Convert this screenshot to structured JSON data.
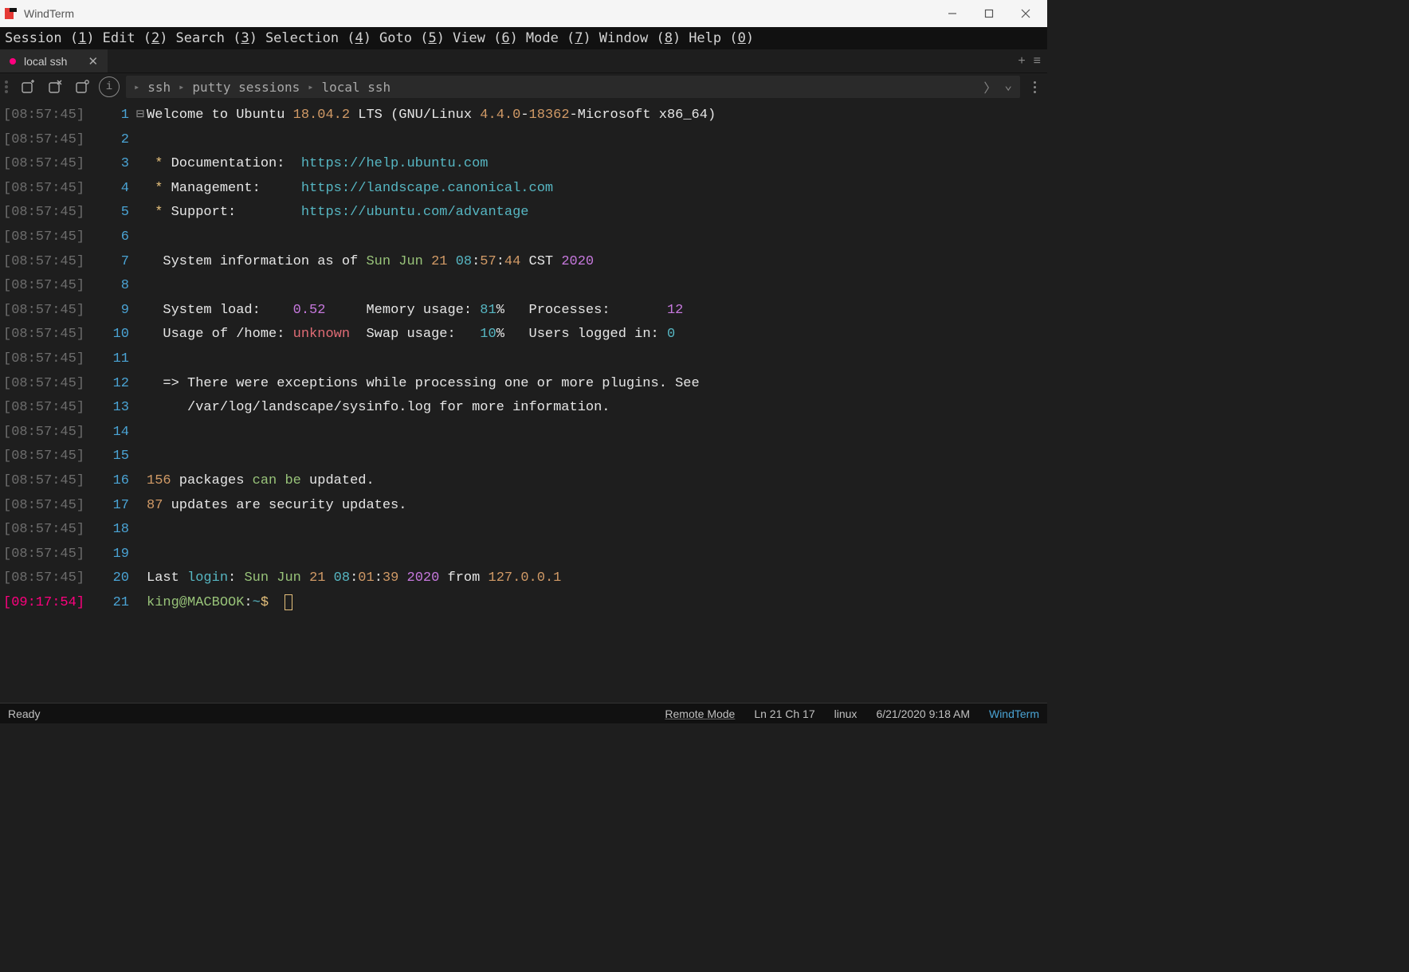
{
  "titlebar": {
    "title": "WindTerm"
  },
  "menubar": {
    "items": [
      {
        "label": "Session",
        "key": "1"
      },
      {
        "label": "Edit",
        "key": "2"
      },
      {
        "label": "Search",
        "key": "3"
      },
      {
        "label": "Selection",
        "key": "4"
      },
      {
        "label": "Goto",
        "key": "5"
      },
      {
        "label": "View",
        "key": "6"
      },
      {
        "label": "Mode",
        "key": "7"
      },
      {
        "label": "Window",
        "key": "8"
      },
      {
        "label": "Help",
        "key": "0"
      }
    ]
  },
  "tab": {
    "label": "local ssh"
  },
  "breadcrumb": {
    "items": [
      "ssh",
      "putty sessions",
      "local ssh"
    ]
  },
  "lines": [
    {
      "ts": "[08:57:45]",
      "ln": "1",
      "fold": "⊟",
      "tokens": [
        {
          "t": "Welcome to Ubuntu ",
          "c": "c-white"
        },
        {
          "t": "18.04.2",
          "c": "c-num"
        },
        {
          "t": " LTS (GNU/Linux ",
          "c": "c-white"
        },
        {
          "t": "4.4.0",
          "c": "c-num"
        },
        {
          "t": "-",
          "c": "c-white"
        },
        {
          "t": "18362",
          "c": "c-num"
        },
        {
          "t": "-Microsoft x86_64)",
          "c": "c-white"
        }
      ]
    },
    {
      "ts": "[08:57:45]",
      "ln": "2",
      "tokens": []
    },
    {
      "ts": "[08:57:45]",
      "ln": "3",
      "tokens": [
        {
          "t": " * ",
          "c": "c-yellow"
        },
        {
          "t": "Documentation:  ",
          "c": "c-white"
        },
        {
          "t": "https://help.ubuntu.com",
          "c": "c-teal"
        }
      ]
    },
    {
      "ts": "[08:57:45]",
      "ln": "4",
      "tokens": [
        {
          "t": " * ",
          "c": "c-yellow"
        },
        {
          "t": "Management:     ",
          "c": "c-white"
        },
        {
          "t": "https://landscape.canonical.com",
          "c": "c-teal"
        }
      ]
    },
    {
      "ts": "[08:57:45]",
      "ln": "5",
      "tokens": [
        {
          "t": " * ",
          "c": "c-yellow"
        },
        {
          "t": "Support:        ",
          "c": "c-white"
        },
        {
          "t": "https://ubuntu.com/advantage",
          "c": "c-teal"
        }
      ]
    },
    {
      "ts": "[08:57:45]",
      "ln": "6",
      "tokens": []
    },
    {
      "ts": "[08:57:45]",
      "ln": "7",
      "tokens": [
        {
          "t": "  System information as of ",
          "c": "c-white"
        },
        {
          "t": "Sun Jun ",
          "c": "c-green"
        },
        {
          "t": "21 ",
          "c": "c-num"
        },
        {
          "t": "08",
          "c": "c-teal"
        },
        {
          "t": ":",
          "c": "c-white"
        },
        {
          "t": "57",
          "c": "c-num"
        },
        {
          "t": ":",
          "c": "c-white"
        },
        {
          "t": "44",
          "c": "c-num"
        },
        {
          "t": " CST ",
          "c": "c-white"
        },
        {
          "t": "2020",
          "c": "c-purple"
        }
      ]
    },
    {
      "ts": "[08:57:45]",
      "ln": "8",
      "tokens": []
    },
    {
      "ts": "[08:57:45]",
      "ln": "9",
      "tokens": [
        {
          "t": "  System load:    ",
          "c": "c-white"
        },
        {
          "t": "0.52",
          "c": "c-purple"
        },
        {
          "t": "     Memory usage: ",
          "c": "c-white"
        },
        {
          "t": "81",
          "c": "c-teal"
        },
        {
          "t": "%   Processes:       ",
          "c": "c-white"
        },
        {
          "t": "12",
          "c": "c-purple"
        }
      ]
    },
    {
      "ts": "[08:57:45]",
      "ln": "10",
      "tokens": [
        {
          "t": "  Usage of /home: ",
          "c": "c-white"
        },
        {
          "t": "unknown",
          "c": "c-red"
        },
        {
          "t": "  Swap usage:   ",
          "c": "c-white"
        },
        {
          "t": "10",
          "c": "c-teal"
        },
        {
          "t": "%   Users logged in: ",
          "c": "c-white"
        },
        {
          "t": "0",
          "c": "c-teal"
        }
      ]
    },
    {
      "ts": "[08:57:45]",
      "ln": "11",
      "tokens": []
    },
    {
      "ts": "[08:57:45]",
      "ln": "12",
      "tokens": [
        {
          "t": "  => There were exceptions while processing one or more plugins. See",
          "c": "c-white"
        }
      ]
    },
    {
      "ts": "[08:57:45]",
      "ln": "13",
      "tokens": [
        {
          "t": "     /var/log/landscape/sysinfo.log for more information.",
          "c": "c-white"
        }
      ]
    },
    {
      "ts": "[08:57:45]",
      "ln": "14",
      "tokens": []
    },
    {
      "ts": "[08:57:45]",
      "ln": "15",
      "tokens": []
    },
    {
      "ts": "[08:57:45]",
      "ln": "16",
      "tokens": [
        {
          "t": "156",
          "c": "c-num"
        },
        {
          "t": " packages ",
          "c": "c-white"
        },
        {
          "t": "can be",
          "c": "c-green"
        },
        {
          "t": " updated.",
          "c": "c-white"
        }
      ]
    },
    {
      "ts": "[08:57:45]",
      "ln": "17",
      "tokens": [
        {
          "t": "87",
          "c": "c-num"
        },
        {
          "t": " updates are security updates.",
          "c": "c-white"
        }
      ]
    },
    {
      "ts": "[08:57:45]",
      "ln": "18",
      "tokens": []
    },
    {
      "ts": "[08:57:45]",
      "ln": "19",
      "tokens": []
    },
    {
      "ts": "[08:57:45]",
      "ln": "20",
      "tokens": [
        {
          "t": "Last ",
          "c": "c-white"
        },
        {
          "t": "login",
          "c": "c-teal"
        },
        {
          "t": ": ",
          "c": "c-white"
        },
        {
          "t": "Sun Jun ",
          "c": "c-green"
        },
        {
          "t": "21 ",
          "c": "c-num"
        },
        {
          "t": "08",
          "c": "c-teal"
        },
        {
          "t": ":",
          "c": "c-white"
        },
        {
          "t": "01",
          "c": "c-num"
        },
        {
          "t": ":",
          "c": "c-white"
        },
        {
          "t": "39 ",
          "c": "c-num"
        },
        {
          "t": "2020",
          "c": "c-purple"
        },
        {
          "t": " from ",
          "c": "c-white"
        },
        {
          "t": "127.0.0.1",
          "c": "c-num"
        }
      ]
    },
    {
      "ts": "[09:17:54]",
      "ln": "21",
      "active": true,
      "tokens": [
        {
          "t": "king@MACBOOK",
          "c": "c-green"
        },
        {
          "t": ":",
          "c": "c-white"
        },
        {
          "t": "~",
          "c": "c-teal"
        },
        {
          "t": "$",
          "c": "c-yellow"
        },
        {
          "t": "  ",
          "c": "c-white"
        }
      ],
      "cursor": true
    }
  ],
  "statusbar": {
    "ready": "Ready",
    "remote": "Remote Mode",
    "pos": "Ln 21 Ch 17",
    "os": "linux",
    "datetime": "6/21/2020 9:18 AM",
    "app": "WindTerm"
  }
}
